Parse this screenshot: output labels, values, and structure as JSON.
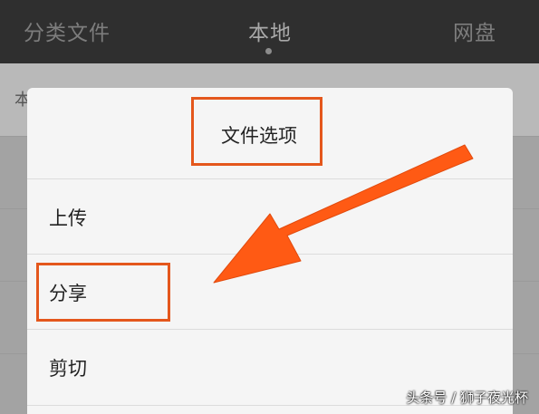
{
  "topbar": {
    "tabs": [
      {
        "label": "分类文件",
        "active": false
      },
      {
        "label": "本地",
        "active": true
      },
      {
        "label": "网盘",
        "active": false
      }
    ]
  },
  "background": {
    "row_text": "本"
  },
  "dialog": {
    "title": "文件选项",
    "items": [
      {
        "label": "上传"
      },
      {
        "label": "分享"
      },
      {
        "label": "剪切"
      }
    ]
  },
  "annotations": {
    "highlight_color": "#e4571c",
    "arrow_color": "#ff5a14"
  },
  "watermark": "头条号 / 狮子夜光杯"
}
